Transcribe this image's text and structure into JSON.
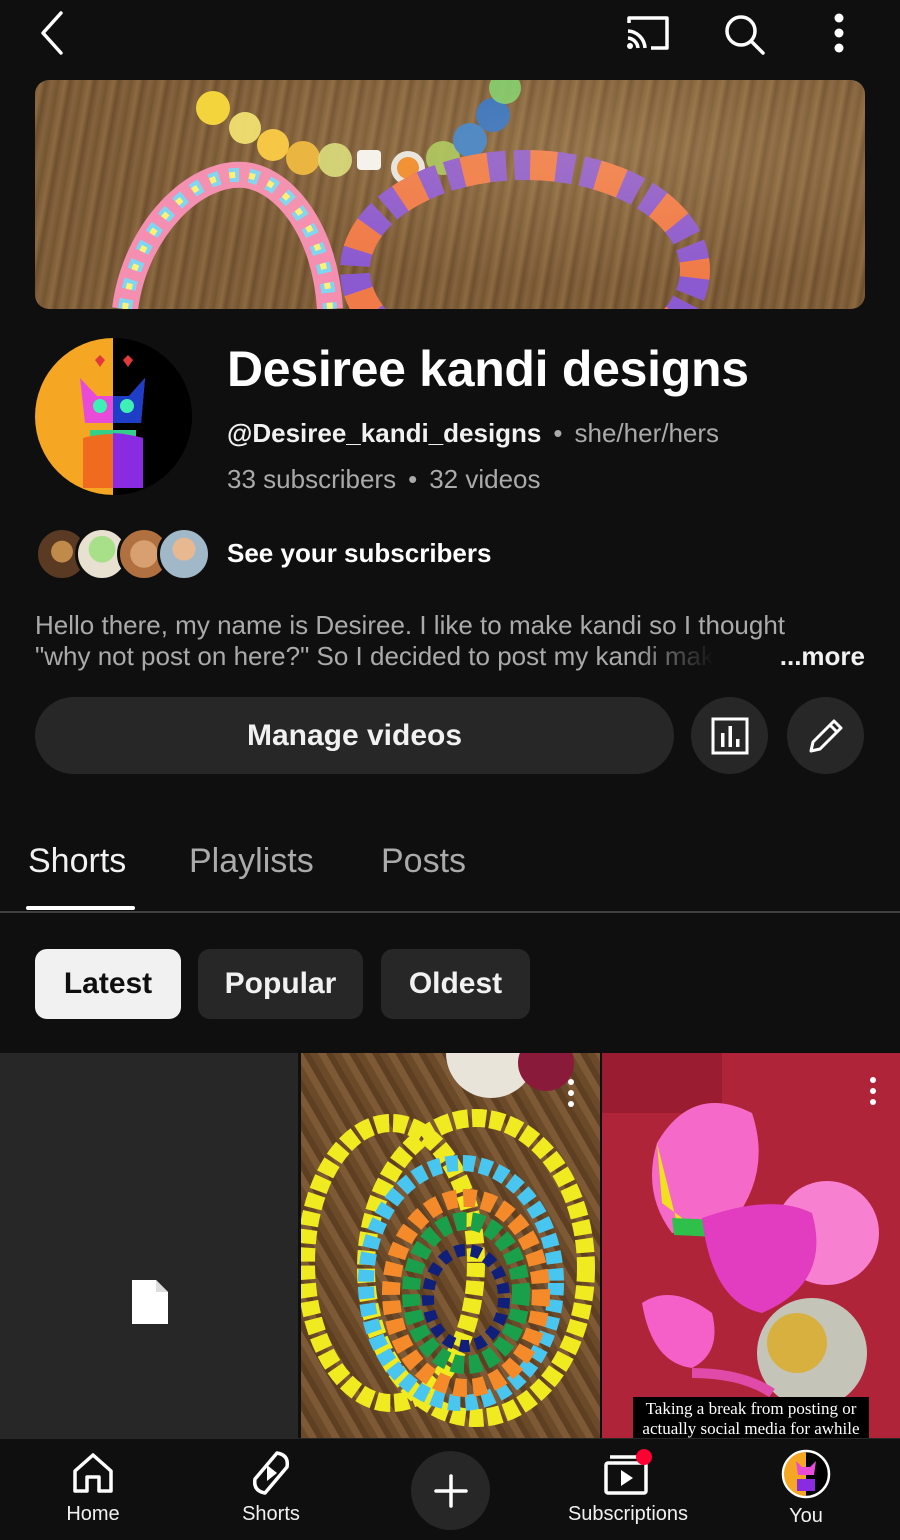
{
  "topbar": {
    "back_icon": "chevron-left-icon",
    "cast_icon": "cast-icon",
    "search_icon": "search-icon",
    "more_icon": "more-vertical-icon"
  },
  "channel": {
    "name": "Desiree kandi designs",
    "handle": "@Desiree_kandi_designs",
    "pronouns": "she/her/hers",
    "subscribers": "33 subscribers",
    "videos": "32 videos",
    "see_subscribers": "See your subscribers",
    "description_line1": "Hello there, my name is Desiree. I like to make kandi so I thought",
    "description_line2": "\"why not post on here?\" So I decided to post my kandi mak",
    "more_label": "...more"
  },
  "actions": {
    "manage_videos": "Manage videos",
    "analytics_icon": "analytics-icon",
    "edit_icon": "pencil-icon"
  },
  "tabs": [
    {
      "label": "Shorts",
      "active": true
    },
    {
      "label": "Playlists",
      "active": false
    },
    {
      "label": "Posts",
      "active": false
    }
  ],
  "chips": [
    {
      "label": "Latest",
      "active": true
    },
    {
      "label": "Popular",
      "active": false
    },
    {
      "label": "Oldest",
      "active": false
    }
  ],
  "shorts": [
    {
      "thumb": "placeholder-document"
    },
    {
      "thumb": "kandi-cuffs-on-wood"
    },
    {
      "thumb": "pink-kandi-on-red",
      "caption": "Taking a break from posting or actually social media for awhile"
    }
  ],
  "nav": [
    {
      "label": "Home",
      "icon": "home-icon"
    },
    {
      "label": "Shorts",
      "icon": "shorts-icon"
    },
    {
      "label": "",
      "icon": "plus-icon"
    },
    {
      "label": "Subscriptions",
      "icon": "subscriptions-icon"
    },
    {
      "label": "You",
      "icon": "avatar"
    }
  ],
  "colors": {
    "background": "#0f0f0f",
    "surface": "#272727",
    "text_primary": "#f1f1f1",
    "text_secondary": "#aaaaaa",
    "notification": "#ff0033"
  }
}
